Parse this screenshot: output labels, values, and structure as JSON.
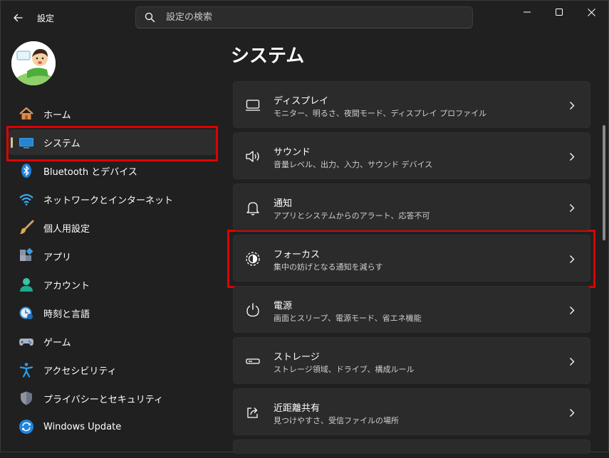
{
  "app": {
    "title": "設定"
  },
  "search": {
    "placeholder": "設定の検索"
  },
  "sidebar": {
    "items": [
      {
        "label": "ホーム",
        "icon": "home-icon",
        "active": false
      },
      {
        "label": "システム",
        "icon": "system-display-icon",
        "active": true
      },
      {
        "label": "Bluetooth とデバイス",
        "icon": "bluetooth-icon",
        "active": false
      },
      {
        "label": "ネットワークとインターネット",
        "icon": "wifi-icon",
        "active": false
      },
      {
        "label": "個人用設定",
        "icon": "brush-icon",
        "active": false
      },
      {
        "label": "アプリ",
        "icon": "apps-icon",
        "active": false
      },
      {
        "label": "アカウント",
        "icon": "account-icon",
        "active": false
      },
      {
        "label": "時刻と言語",
        "icon": "time-language-icon",
        "active": false
      },
      {
        "label": "ゲーム",
        "icon": "gamepad-icon",
        "active": false
      },
      {
        "label": "アクセシビリティ",
        "icon": "accessibility-icon",
        "active": false
      },
      {
        "label": "プライバシーとセキュリティ",
        "icon": "shield-icon",
        "active": false
      },
      {
        "label": "Windows Update",
        "icon": "update-icon",
        "active": false
      }
    ]
  },
  "main": {
    "title": "システム",
    "cards": [
      {
        "title": "ディスプレイ",
        "subtitle": "モニター、明るさ、夜間モード、ディスプレイ プロファイル",
        "icon": "display-icon"
      },
      {
        "title": "サウンド",
        "subtitle": "音量レベル、出力、入力、サウンド デバイス",
        "icon": "speaker-icon"
      },
      {
        "title": "通知",
        "subtitle": "アプリとシステムからのアラート、応答不可",
        "icon": "bell-icon"
      },
      {
        "title": "フォーカス",
        "subtitle": "集中の妨げとなる通知を減らす",
        "icon": "focus-icon"
      },
      {
        "title": "電源",
        "subtitle": "画面とスリープ、電源モード、省エネ機能",
        "icon": "power-icon"
      },
      {
        "title": "ストレージ",
        "subtitle": "ストレージ領域、ドライブ、構成ルール",
        "icon": "storage-icon"
      },
      {
        "title": "近距離共有",
        "subtitle": "見つけやすさ、受信ファイルの場所",
        "icon": "share-icon"
      }
    ]
  },
  "colors": {
    "accent": "#d8c48e",
    "highlight": "#e00000",
    "background": "#202020",
    "card": "#2b2b2b"
  }
}
